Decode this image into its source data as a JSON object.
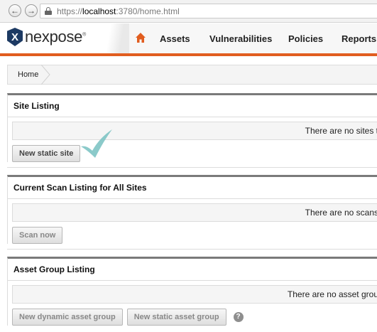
{
  "browser": {
    "url_scheme": "https://",
    "url_host": "localhost",
    "url_path": ":3780/home.html"
  },
  "app": {
    "logo_text": "nexpose",
    "logo_mark": "X",
    "logo_reg": "®",
    "nav": {
      "assets": "Assets",
      "vulnerabilities": "Vulnerabilities",
      "policies": "Policies",
      "reports": "Reports"
    },
    "accent_color": "#e15d1f"
  },
  "breadcrumb": {
    "home": "Home"
  },
  "site_listing": {
    "title": "Site Listing",
    "empty_text": "There are no sites t",
    "new_static_site": "New static site"
  },
  "scan_listing": {
    "title": "Current Scan Listing for All Sites",
    "empty_text": "There are no scans",
    "scan_now": "Scan now"
  },
  "asset_group_listing": {
    "title": "Asset Group Listing",
    "empty_text": "There are no asset grou",
    "new_dynamic": "New dynamic asset group",
    "new_static": "New static asset group",
    "help": "?"
  },
  "icons": {
    "back": "back-arrow-icon",
    "forward": "forward-arrow-icon",
    "lock": "lock-icon",
    "home": "home-icon",
    "help": "help-icon",
    "checkmark": "checkmark-annotation-icon"
  }
}
